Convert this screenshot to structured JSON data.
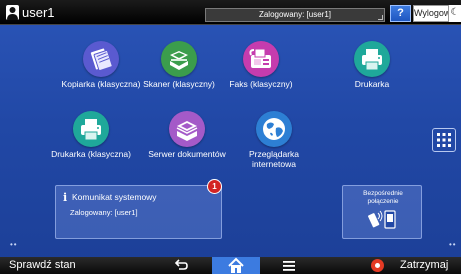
{
  "topbar": {
    "user_name": "user1",
    "status_text": "Zalogowany: [user1]",
    "help_label": "?",
    "logout_label": "Wylogowanie"
  },
  "apps": [
    {
      "label": "Kopiarka (klasyczna)",
      "icon": "copier-icon",
      "color": "#5a5ad0"
    },
    {
      "label": "Skaner (klasyczny)",
      "icon": "scanner-icon",
      "color": "#3b9d4c"
    },
    {
      "label": "Faks (klasyczny)",
      "icon": "fax-icon",
      "color": "#c53cae"
    },
    {
      "label": "Drukarka",
      "icon": "printer-icon",
      "color": "#1fa89a"
    },
    {
      "label": "Drukarka (klasyczna)",
      "icon": "classic-printer-icon",
      "color": "#1fa89a"
    },
    {
      "label": "Serwer dokumentów",
      "icon": "document-server-icon",
      "color": "#a45ac8"
    },
    {
      "label": "Przeglądarka internetowa",
      "icon": "web-browser-icon",
      "color": "#2d7fd4"
    }
  ],
  "system_message": {
    "title": "Komunikat systemowy",
    "body": "Zalogowany: [user1]",
    "badge_count": "1"
  },
  "direct_connection": {
    "title": "Bezpośrednie połączenie"
  },
  "bottombar": {
    "check_status_label": "Sprawdź stan",
    "stop_label": "Zatrzymaj"
  }
}
